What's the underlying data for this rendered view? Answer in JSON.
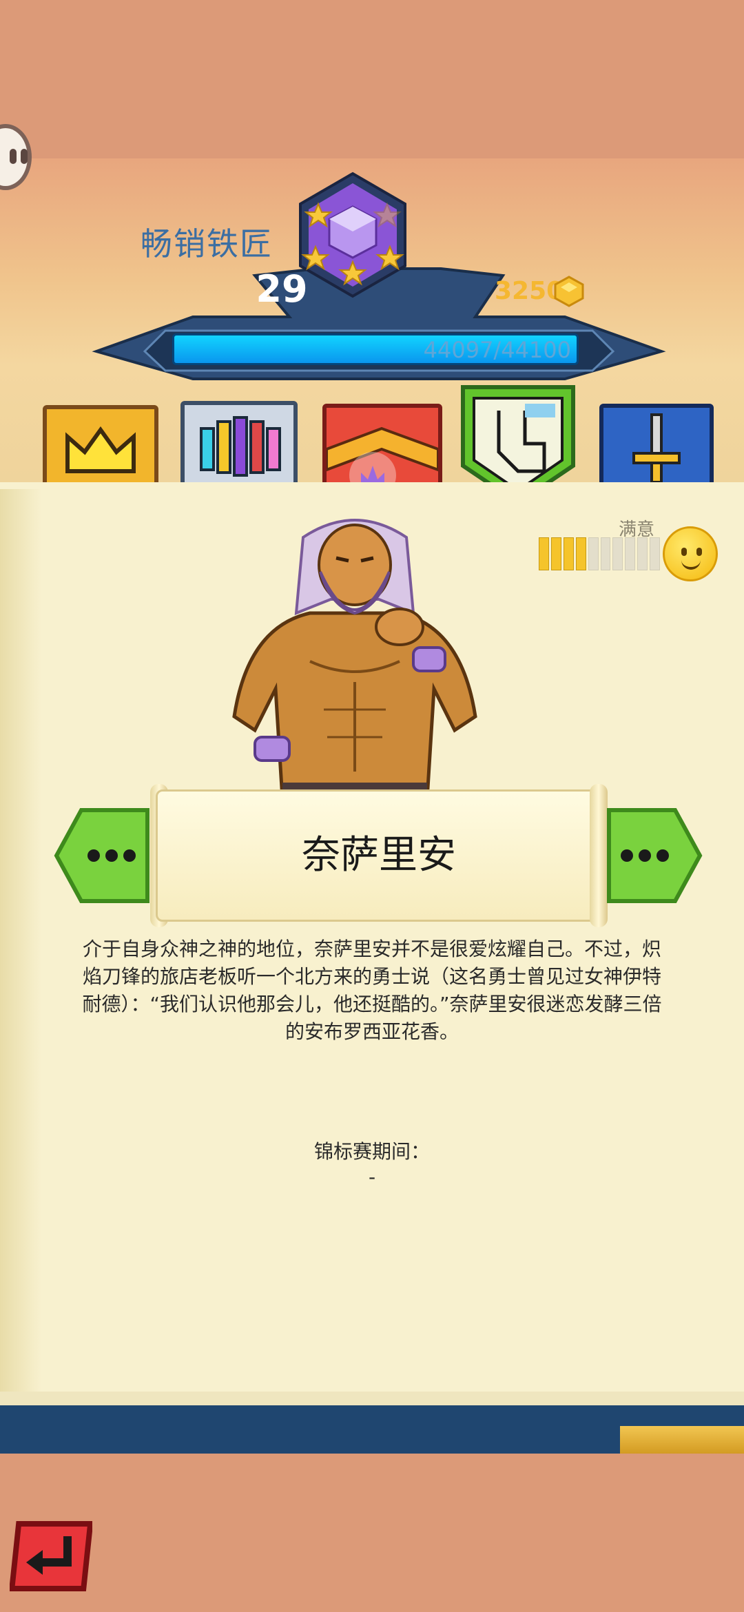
{
  "header": {
    "shop_title": "畅销铁匠",
    "level": "29",
    "gold": "3250",
    "xp_text": "44097/44100",
    "xp_progress": 0.9999
  },
  "tabs": [
    {
      "name": "crown",
      "color": "#f0b429",
      "active": false
    },
    {
      "name": "guild",
      "color": "#5aa0d8",
      "active": false
    },
    {
      "name": "banner",
      "color": "#e0403a",
      "active": false
    },
    {
      "name": "hero",
      "color": "#5cc030",
      "active": true
    },
    {
      "name": "sword",
      "color": "#2e62c2",
      "active": false
    }
  ],
  "satisfaction": {
    "label": "满意",
    "filled_segments": 4,
    "total_segments": 10
  },
  "hero": {
    "name": "奈萨里安",
    "description": "介于自身众神之神的地位，奈萨里安并不是很爱炫耀自己。不过，炽焰刀锋的旅店老板听一个北方来的勇士说（这名勇士曾见过女神伊特耐德）：“我们认识他那会儿，他还挺酷的。”奈萨里安很迷恋发酵三倍的安布罗西亚花香。"
  },
  "tournament": {
    "label": "锦标赛期间：",
    "value": "-"
  },
  "icons": {
    "chat": "chat-bubble-icon",
    "badge": "hexagon-star-badge-icon",
    "gold": "gold-gem-icon",
    "prev": "ellipsis-left-arrow-icon",
    "next": "ellipsis-right-arrow-icon",
    "back": "return-arrow-icon"
  }
}
